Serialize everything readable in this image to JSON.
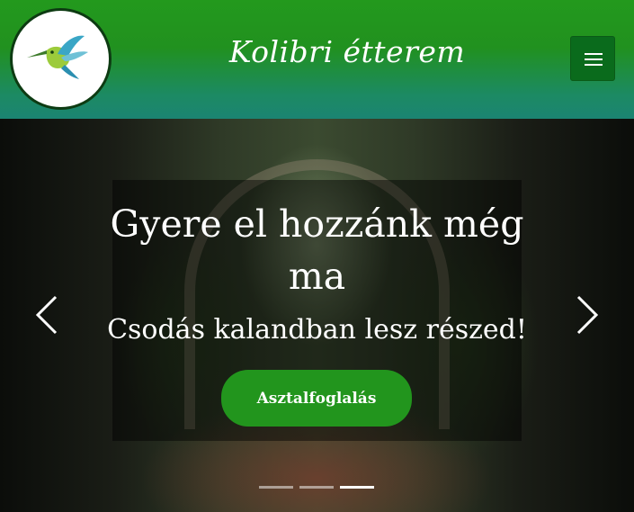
{
  "header": {
    "brand": "Kolibri étterem",
    "logo_icon": "hummingbird-icon",
    "menu_icon": "hamburger-menu-icon",
    "colors": {
      "primary": "#23991d",
      "gradient_end": "#1b8472",
      "menu_button": "#0a6b1c"
    }
  },
  "hero": {
    "title": "Gyere el hozzánk még ma",
    "subtitle": "Csodás kalandban lesz részed!",
    "cta_label": "Asztalfoglalás",
    "prev_icon": "chevron-left-icon",
    "next_icon": "chevron-right-icon",
    "slide_count": 3,
    "active_slide": 3,
    "colors": {
      "cta": "#22951d"
    }
  }
}
